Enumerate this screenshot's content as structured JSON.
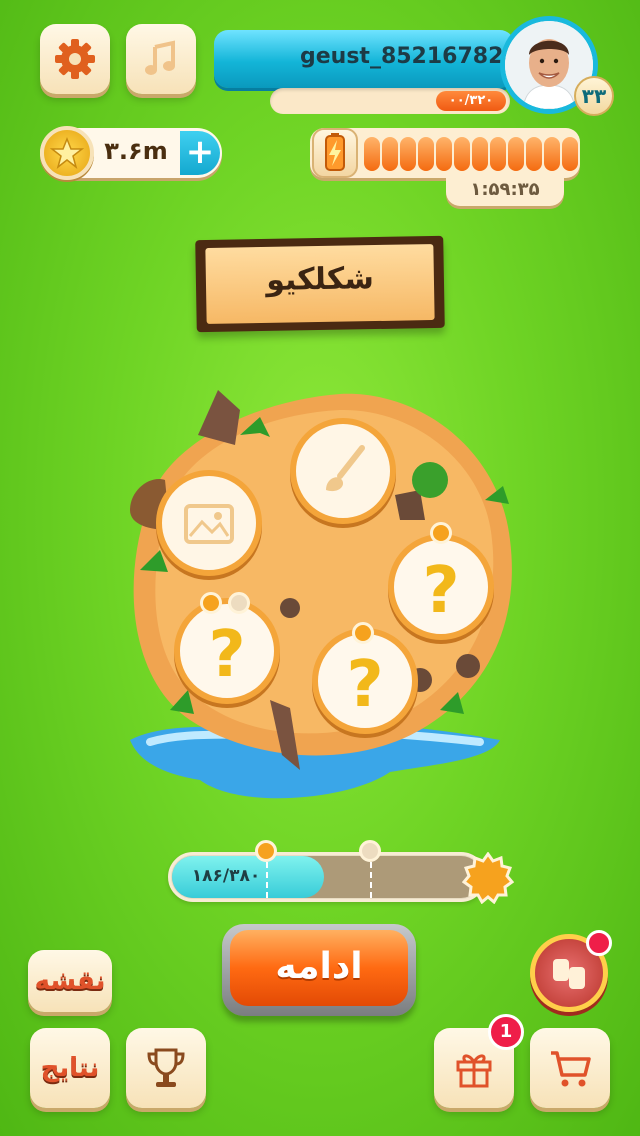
{
  "profile": {
    "username": "geust_85216782",
    "level": "۳۳",
    "xp": "۰۰/۳۲۰"
  },
  "coins": {
    "value": "۳.۶m",
    "add_label": "+"
  },
  "energy": {
    "segments": 12,
    "timer": "۱:۵۹:۳۵"
  },
  "title": "شکلکیو",
  "progress": {
    "text": "۱۸۶/۳۸۰",
    "current": 186,
    "total": 380
  },
  "buttons": {
    "continue": "ادامه",
    "map": "نقشه",
    "results": "نتایج"
  },
  "badges": {
    "gift_count": "1"
  },
  "icons": {
    "settings": "gear-icon",
    "music": "music-note-icon",
    "coin": "star-coin-icon",
    "energy": "lightning-battery-icon",
    "image_level": "image-icon",
    "brush_level": "brush-icon",
    "locked_level": "question-mark-icon",
    "trophy": "trophy-icon",
    "gift": "gift-icon",
    "cart": "cart-icon",
    "social": "handshake-icon"
  },
  "colors": {
    "accent_blue": "#19b9dd",
    "accent_orange": "#ff6a12",
    "background_green": "#6fd425"
  }
}
